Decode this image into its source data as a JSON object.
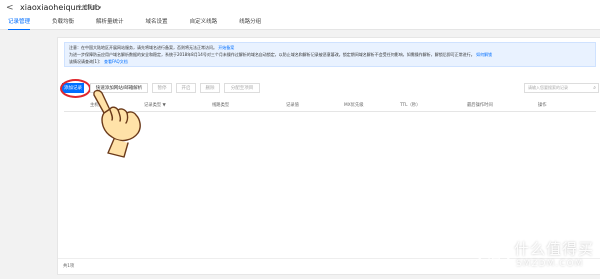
{
  "header": {
    "back": "<",
    "domain": "xiaoxiaoheiqun.club",
    "badge": "全部项目 ▾",
    "tabs": [
      "记录管理",
      "负载均衡",
      "解析量统计",
      "域名设置",
      "自定义线路",
      "线路分组"
    ]
  },
  "notice": {
    "line1_text": "注意：在中国大陆地区开展网站服务，请先将域名进行备案，否则将无法正常访问。",
    "line1_link": "开始备案",
    "line2_text": "为进一步保障防云应用户域名解析数据的安全和稳定，系统于2018年8月14号对三个月未操作过解析的域名自动锁定，以防止域名和解析记录被恶意篡改。锁定期间域名解析不会受任何影响，如需操作解析，解锁后即可正常进行。",
    "line2_link": "如何解锁",
    "line3_text": "该情况请查询[1]：",
    "line3_link": "查看FAQ文档"
  },
  "toolbar": {
    "add_record": "添加记录",
    "quick_add": "快速添加网站/邮箱解析",
    "pause": "暂停",
    "enable": "开启",
    "delete": "删除",
    "batch": "分配至项目",
    "search_placeholder": "请输入您要搜索的记录"
  },
  "table": {
    "columns": [
      "主机记录",
      "记录类型 ▼",
      "线路类型",
      "记录值",
      "MX优先级",
      "TTL（秒）",
      "最后操作时间",
      "操作"
    ]
  },
  "footer": {
    "total": "共1项"
  },
  "watermark": {
    "brand": "什么值得买",
    "sub": "SMZDM.COM"
  }
}
